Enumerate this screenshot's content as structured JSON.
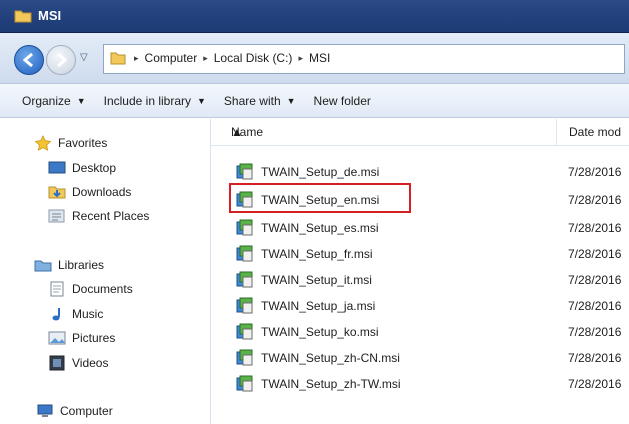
{
  "window": {
    "title": "MSI"
  },
  "address": {
    "crumbs": [
      "Computer",
      "Local Disk (C:)",
      "MSI"
    ]
  },
  "toolbar": {
    "organize": "Organize",
    "include": "Include in library",
    "share": "Share with",
    "new_folder": "New folder"
  },
  "nav": {
    "favorites": "Favorites",
    "desktop": "Desktop",
    "downloads": "Downloads",
    "recent": "Recent Places",
    "libraries": "Libraries",
    "documents": "Documents",
    "music": "Music",
    "pictures": "Pictures",
    "videos": "Videos",
    "computer": "Computer"
  },
  "columns": {
    "name": "Name",
    "date": "Date mod"
  },
  "files": [
    {
      "name": "TWAIN_Setup_de.msi",
      "date": "7/28/2016"
    },
    {
      "name": "TWAIN_Setup_en.msi",
      "date": "7/28/2016"
    },
    {
      "name": "TWAIN_Setup_es.msi",
      "date": "7/28/2016"
    },
    {
      "name": "TWAIN_Setup_fr.msi",
      "date": "7/28/2016"
    },
    {
      "name": "TWAIN_Setup_it.msi",
      "date": "7/28/2016"
    },
    {
      "name": "TWAIN_Setup_ja.msi",
      "date": "7/28/2016"
    },
    {
      "name": "TWAIN_Setup_ko.msi",
      "date": "7/28/2016"
    },
    {
      "name": "TWAIN_Setup_zh-CN.msi",
      "date": "7/28/2016"
    },
    {
      "name": "TWAIN_Setup_zh-TW.msi",
      "date": "7/28/2016"
    }
  ],
  "colors": {
    "highlight": "#d42020",
    "titlebar": "#1c3a74"
  }
}
